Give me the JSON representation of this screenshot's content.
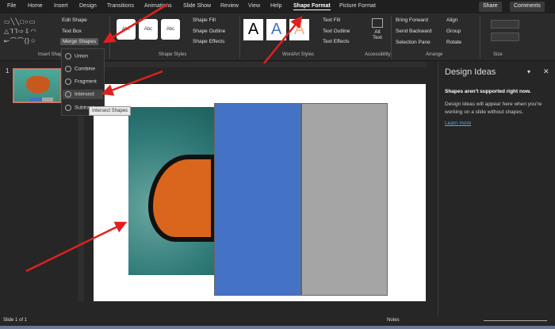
{
  "tabs": [
    "File",
    "Home",
    "Insert",
    "Design",
    "Transitions",
    "Animations",
    "Slide Show",
    "Review",
    "View",
    "Help",
    "Shape Format",
    "Picture Format"
  ],
  "share": "Share",
  "comments": "Comments",
  "insert_shapes": {
    "edit_shape": "Edit Shape",
    "text_box": "Text Box",
    "merge_shapes": "Merge Shapes",
    "label": "Insert Shapes"
  },
  "shape_styles": {
    "abc": "Abc",
    "fill": "Shape Fill",
    "outline": "Shape Outline",
    "effects": "Shape Effects",
    "label": "Shape Styles"
  },
  "wordart": {
    "a": "A",
    "fill": "Text Fill",
    "outline": "Text Outline",
    "effects": "Text Effects",
    "label": "WordArt Styles"
  },
  "accessibility": {
    "alt1": "Alt",
    "alt2": "Text",
    "label": "Accessibility"
  },
  "arrange": {
    "bring": "Bring Forward",
    "send": "Send Backward",
    "pane": "Selection Pane",
    "align": "Align",
    "group": "Group",
    "rotate": "Rotate",
    "label": "Arrange"
  },
  "size": {
    "label": "Size"
  },
  "merge_menu": [
    "Union",
    "Combine",
    "Fragment",
    "Intersect",
    "Subtract"
  ],
  "tooltip": "Intersect Shapes",
  "slide_number": "1",
  "design_ideas": {
    "title": "Design Ideas",
    "heading": "Shapes aren't supported right now.",
    "body": "Design Ideas will appear here when you're working on a slide without shapes.",
    "link": "Learn more"
  },
  "status": {
    "slide": "Slide 1 of 1",
    "notes": "Notes"
  },
  "colors": {
    "blue": "#4472c4",
    "gray": "#a5a5a5",
    "arrow": "#e02020"
  }
}
